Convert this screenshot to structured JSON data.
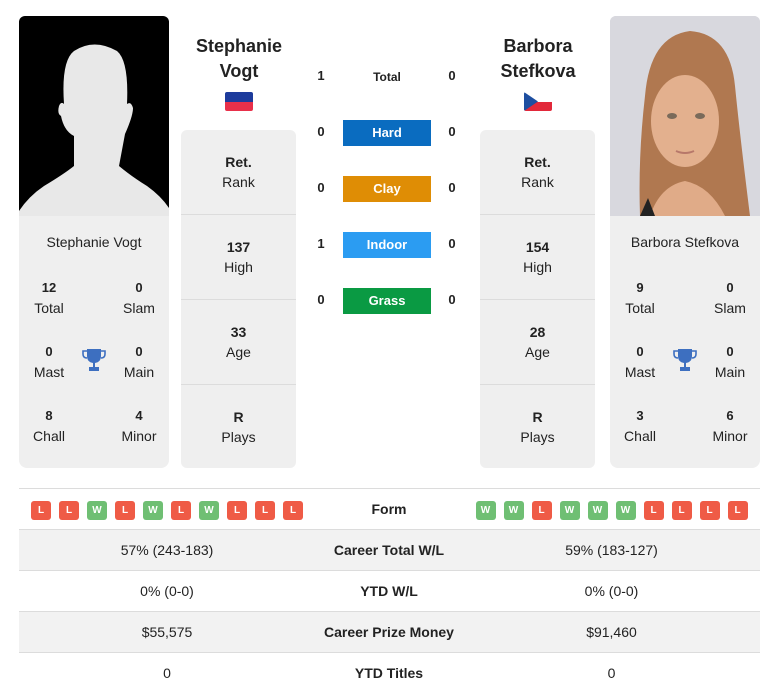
{
  "player1": {
    "name_line1": "Stephanie",
    "name_line2": "Vogt",
    "full_name": "Stephanie Vogt",
    "country_flag": "liechtenstein-flag",
    "rank": {
      "value": "Ret.",
      "label": "Rank"
    },
    "high": {
      "value": "137",
      "label": "High"
    },
    "age": {
      "value": "33",
      "label": "Age"
    },
    "plays": {
      "value": "R",
      "label": "Plays"
    },
    "titles": {
      "total": {
        "value": "12",
        "label": "Total"
      },
      "slam": {
        "value": "0",
        "label": "Slam"
      },
      "mast": {
        "value": "0",
        "label": "Mast"
      },
      "main": {
        "value": "0",
        "label": "Main"
      },
      "chall": {
        "value": "8",
        "label": "Chall"
      },
      "minor": {
        "value": "4",
        "label": "Minor"
      }
    },
    "form": [
      "L",
      "L",
      "W",
      "L",
      "W",
      "L",
      "W",
      "L",
      "L",
      "L"
    ],
    "career_wl": "57% (243-183)",
    "ytd_wl": "0% (0-0)",
    "prize_money": "$55,575",
    "ytd_titles": "0"
  },
  "player2": {
    "name_line1": "Barbora",
    "name_line2": "Stefkova",
    "full_name": "Barbora Stefkova",
    "country_flag": "czech-flag",
    "rank": {
      "value": "Ret.",
      "label": "Rank"
    },
    "high": {
      "value": "154",
      "label": "High"
    },
    "age": {
      "value": "28",
      "label": "Age"
    },
    "plays": {
      "value": "R",
      "label": "Plays"
    },
    "titles": {
      "total": {
        "value": "9",
        "label": "Total"
      },
      "slam": {
        "value": "0",
        "label": "Slam"
      },
      "mast": {
        "value": "0",
        "label": "Mast"
      },
      "main": {
        "value": "0",
        "label": "Main"
      },
      "chall": {
        "value": "3",
        "label": "Chall"
      },
      "minor": {
        "value": "6",
        "label": "Minor"
      }
    },
    "form": [
      "W",
      "W",
      "L",
      "W",
      "W",
      "W",
      "L",
      "L",
      "L",
      "L"
    ],
    "career_wl": "59% (183-127)",
    "ytd_wl": "0% (0-0)",
    "prize_money": "$91,460",
    "ytd_titles": "0"
  },
  "h2h": [
    {
      "label": "Total",
      "p1": "1",
      "p2": "0",
      "color": ""
    },
    {
      "label": "Hard",
      "p1": "0",
      "p2": "0",
      "color": "#0a6cc0"
    },
    {
      "label": "Clay",
      "p1": "0",
      "p2": "0",
      "color": "#df8d05"
    },
    {
      "label": "Indoor",
      "p1": "1",
      "p2": "0",
      "color": "#2b9cf2"
    },
    {
      "label": "Grass",
      "p1": "0",
      "p2": "0",
      "color": "#0a9a43"
    }
  ],
  "table_labels": {
    "form": "Form",
    "career_wl": "Career Total W/L",
    "ytd_wl": "YTD W/L",
    "prize_money": "Career Prize Money",
    "ytd_titles": "YTD Titles"
  }
}
